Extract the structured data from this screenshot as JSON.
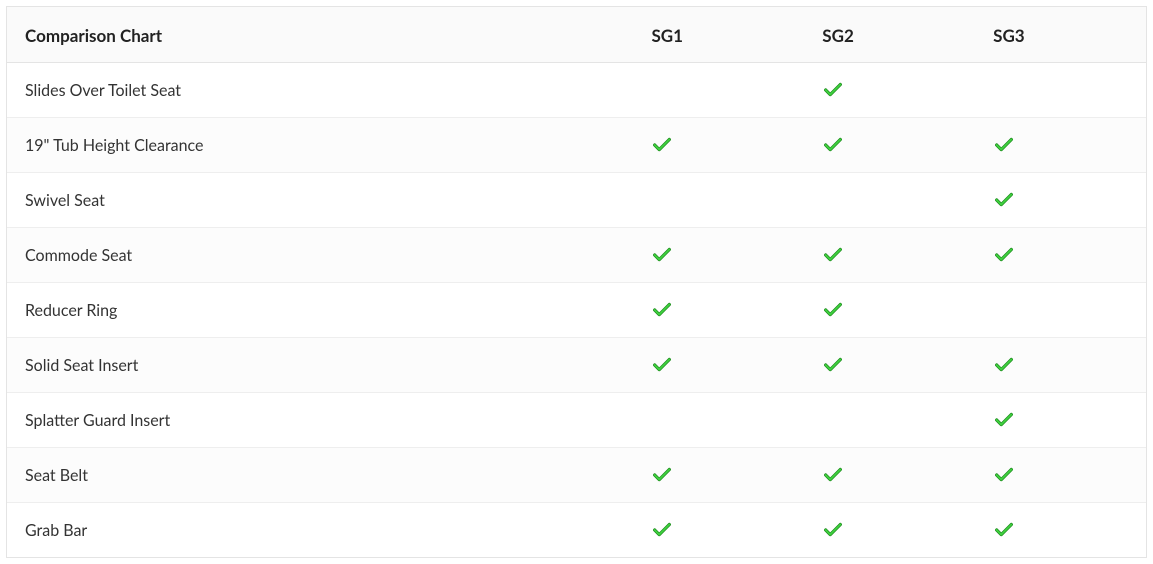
{
  "chart_data": {
    "type": "table",
    "title": "Comparison Chart",
    "columns": [
      "SG1",
      "SG2",
      "SG3"
    ],
    "rows": [
      {
        "feature": "Slides Over Toilet Seat",
        "values": [
          false,
          true,
          false
        ]
      },
      {
        "feature": "19\" Tub Height Clearance",
        "values": [
          true,
          true,
          true
        ]
      },
      {
        "feature": "Swivel Seat",
        "values": [
          false,
          false,
          true
        ]
      },
      {
        "feature": "Commode Seat",
        "values": [
          true,
          true,
          true
        ]
      },
      {
        "feature": "Reducer Ring",
        "values": [
          true,
          true,
          false
        ]
      },
      {
        "feature": "Solid Seat Insert",
        "values": [
          true,
          true,
          true
        ]
      },
      {
        "feature": "Splatter Guard Insert",
        "values": [
          false,
          false,
          true
        ]
      },
      {
        "feature": "Seat Belt",
        "values": [
          true,
          true,
          true
        ]
      },
      {
        "feature": "Grab Bar",
        "values": [
          true,
          true,
          true
        ]
      }
    ]
  }
}
